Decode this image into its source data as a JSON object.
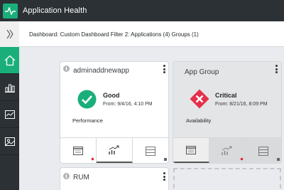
{
  "header": {
    "title": "Application Health"
  },
  "breadcrumb": {
    "text": "Dashboard: Custom Dashboard Filter 2: Applications (4) Groups (1)"
  },
  "sidebar": {
    "items": [
      {
        "icon": "home-icon",
        "active": true
      },
      {
        "icon": "bar-chart-icon",
        "active": false
      },
      {
        "icon": "line-chart-icon",
        "active": false
      },
      {
        "icon": "image-icon",
        "active": false
      }
    ]
  },
  "cards": [
    {
      "title": "adminaddnewapp",
      "status": "Good",
      "from": "From: 9/4/16, 4:10 PM",
      "kpi": "Performance",
      "status_icon": "check-icon",
      "status_color": "#1aaf7a"
    },
    {
      "title": "App Group",
      "status": "Critical",
      "from": "From: 8/21/16, 8:09 PM",
      "kpi": "Availability",
      "status_icon": "critical-x-icon",
      "status_color": "#e5304a"
    },
    {
      "title": "RUM"
    }
  ],
  "colors": {
    "accent": "#1aaf7a",
    "critical": "#e5304a",
    "topbar": "#2b3135",
    "alert_marker": "#e0112b"
  }
}
